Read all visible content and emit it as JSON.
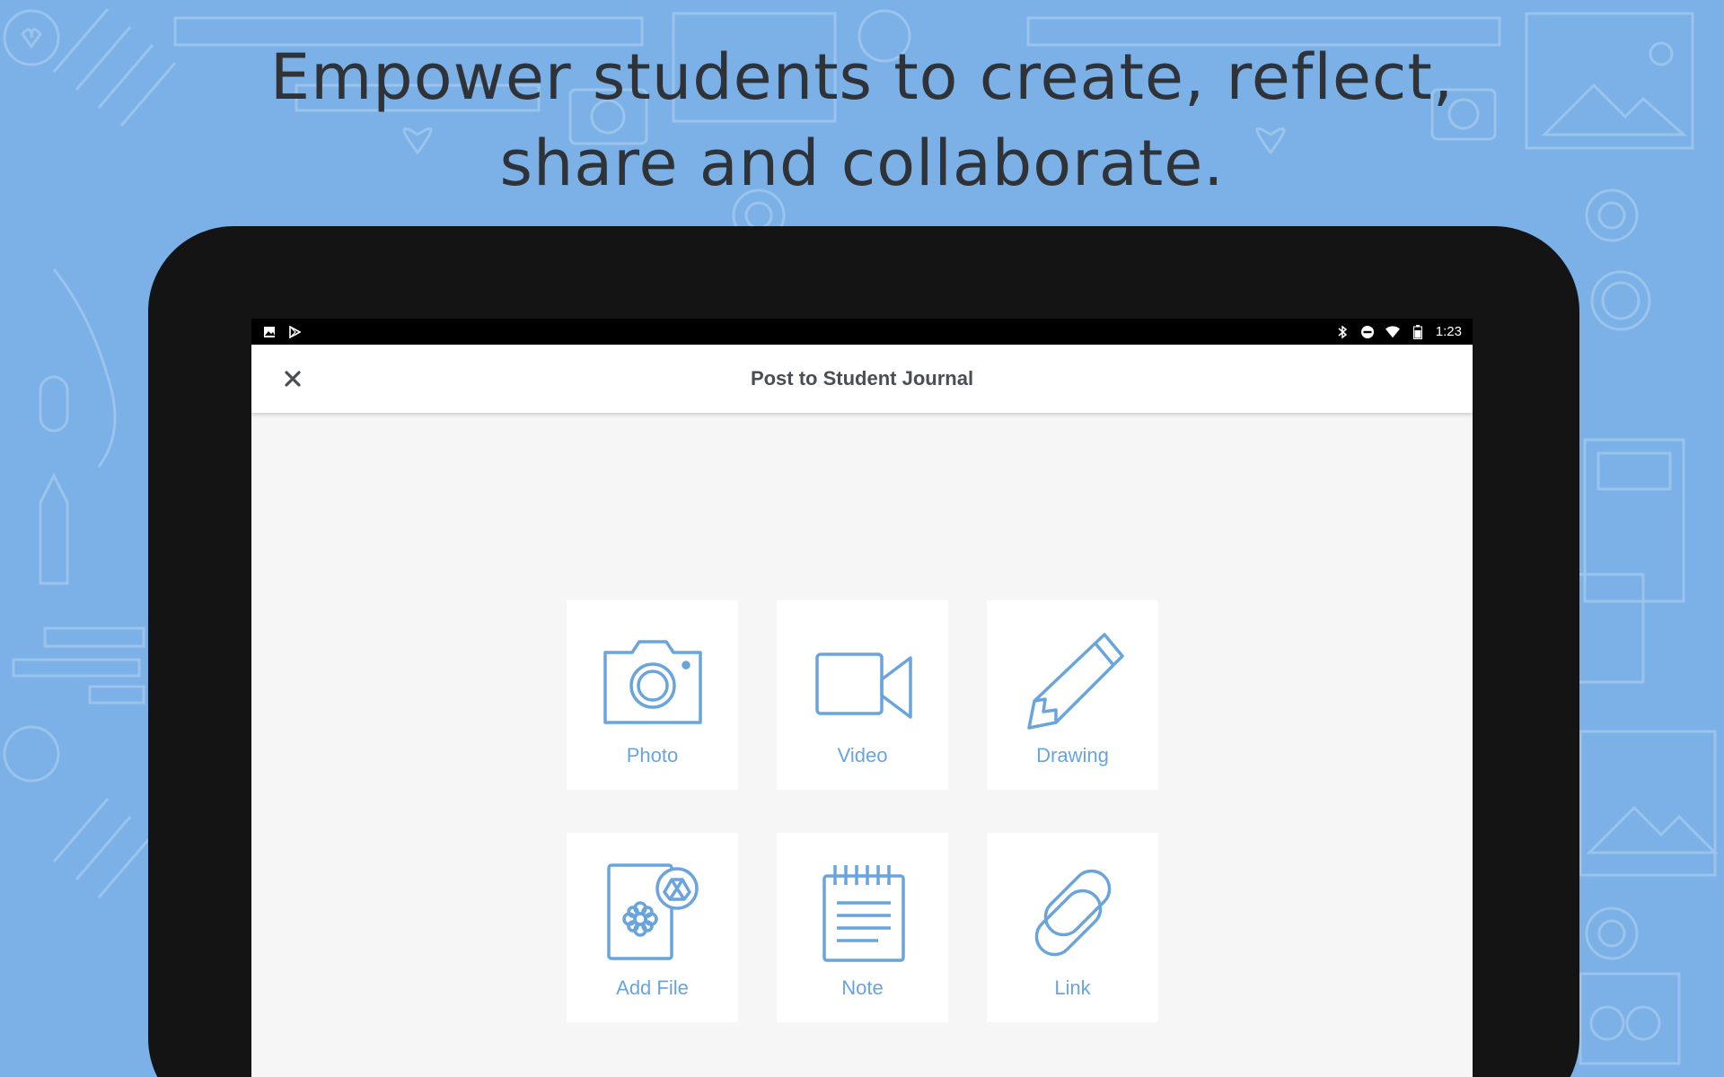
{
  "headline": {
    "line1": "Empower students to create, reflect,",
    "line2": "share and collaborate."
  },
  "status_bar": {
    "time": "1:23",
    "left_icons": [
      "image-icon",
      "play-store-icon"
    ],
    "right_icons": [
      "bluetooth-icon",
      "do-not-disturb-icon",
      "wifi-icon",
      "battery-icon"
    ]
  },
  "app_bar": {
    "title": "Post to Student Journal",
    "close_icon": "close-icon"
  },
  "tiles": [
    {
      "label": "Photo",
      "icon": "camera-icon"
    },
    {
      "label": "Video",
      "icon": "video-camera-icon"
    },
    {
      "label": "Drawing",
      "icon": "pencil-icon"
    },
    {
      "label": "Add File",
      "icon": "file-drive-icon"
    },
    {
      "label": "Note",
      "icon": "notepad-icon"
    },
    {
      "label": "Link",
      "icon": "link-icon"
    }
  ],
  "colors": {
    "background": "#7bb1e6",
    "accent": "#6aa4dd",
    "title_text": "#4a4e54",
    "headline_text": "#2f3337"
  }
}
